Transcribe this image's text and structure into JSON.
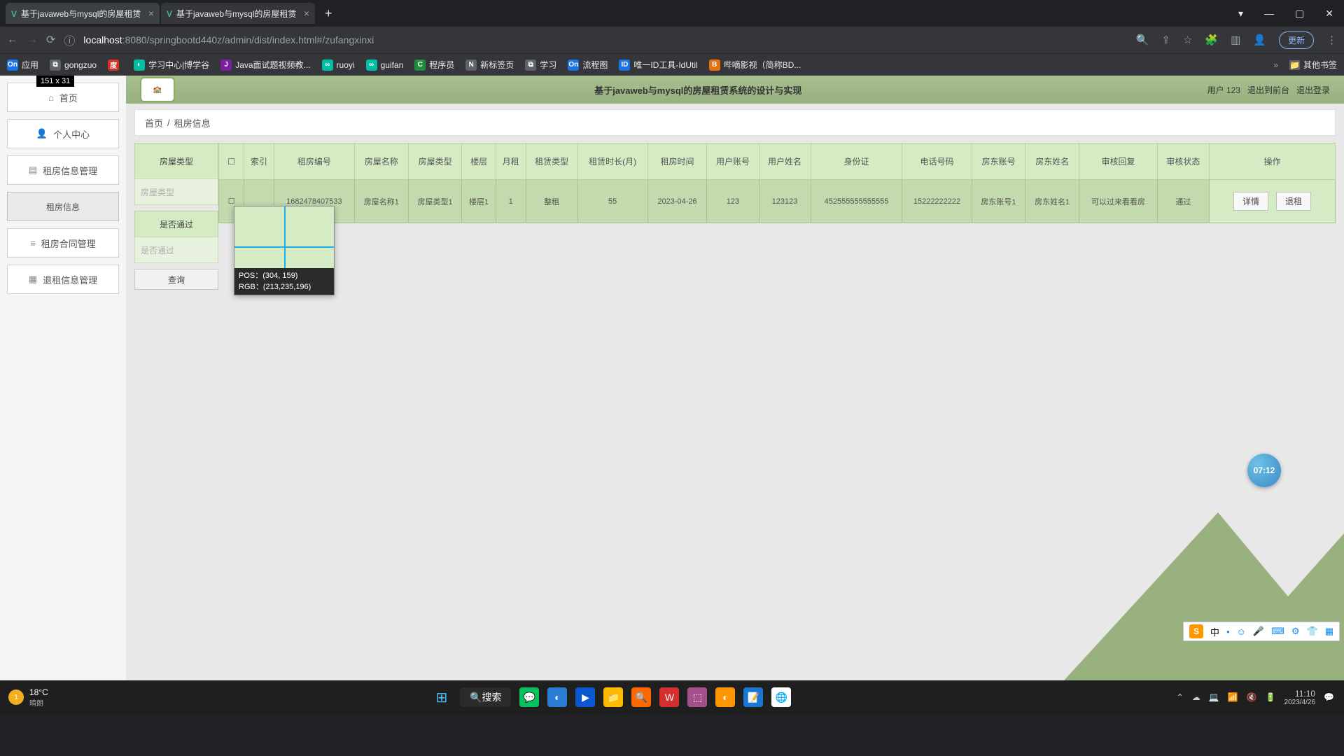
{
  "browser": {
    "tabs": [
      {
        "title": "基于javaweb与mysql的房屋租赁"
      },
      {
        "title": "基于javaweb与mysql的房屋租赁"
      }
    ],
    "url_host": "localhost",
    "url_port": ":8080",
    "url_path": "/springbootd440z/admin/dist/index.html#/zufangxinxi",
    "update_label": "更新",
    "bookmarks": [
      "应用",
      "gongzuo",
      "百度一下，你就知道",
      "学习中心|博学谷",
      "Java面试题视频教...",
      "ruoyi",
      "guifan",
      "程序员",
      "新标签页",
      "学习",
      "流程图",
      "唯一ID工具-IdUtil",
      "哔嘀影视（简称BD...",
      "其他书签"
    ]
  },
  "page": {
    "sidebar": {
      "home": "首页",
      "personal": "个人中心",
      "rent_info_mgmt": "租房信息管理",
      "rent_info_sub": "租房信息",
      "contract_mgmt": "租房合同管理",
      "cancel_mgmt": "退租信息管理"
    },
    "header_title": "基于javaweb与mysql的房屋租赁系统的设计与实现",
    "user_label": "用户 123",
    "exit_front": "退出到前台",
    "exit_login": "退出登录",
    "breadcrumb_home": "首页",
    "breadcrumb_current": "租房信息",
    "filters": {
      "type_label": "房屋类型",
      "type_placeholder": "房屋类型",
      "pass_label": "是否通过",
      "pass_placeholder": "是否通过",
      "query_btn": "查询"
    },
    "table": {
      "headers": [
        "",
        "索引",
        "租房编号",
        "房屋名称",
        "房屋类型",
        "楼层",
        "月租",
        "租赁类型",
        "租赁时长(月)",
        "租房时间",
        "用户账号",
        "用户姓名",
        "身份证",
        "电话号码",
        "房东账号",
        "房东姓名",
        "审核回复",
        "审核状态",
        "操作"
      ],
      "rows": [
        {
          "idx": "",
          "code": "1682478407533",
          "name": "房屋名称1",
          "type": "房屋类型1",
          "floor": "楼层1",
          "rent": "1",
          "lease": "整租",
          "months": "55",
          "time": "2023-04-26",
          "uacc": "123",
          "uname": "123123",
          "idcard": "452555555555555",
          "phone": "15222222222",
          "lacc": "房东账号1",
          "lname": "房东姓名1",
          "reply": "可以过来看看房",
          "status": "通过"
        }
      ],
      "op_detail": "详情",
      "op_cancel": "退租"
    }
  },
  "screenshot_tool": {
    "size_label": "151 x 31",
    "pos_label": "POS：(304, 159)",
    "rgb_label": "RGB：(213,235,196)"
  },
  "clock_badge": "07:12",
  "taskbar": {
    "temp": "18°C",
    "cond": "晴朗",
    "badge": "1",
    "search": "搜索",
    "time": "11:10",
    "date": "2023/4/26"
  },
  "ime": {
    "zhong": "中"
  }
}
